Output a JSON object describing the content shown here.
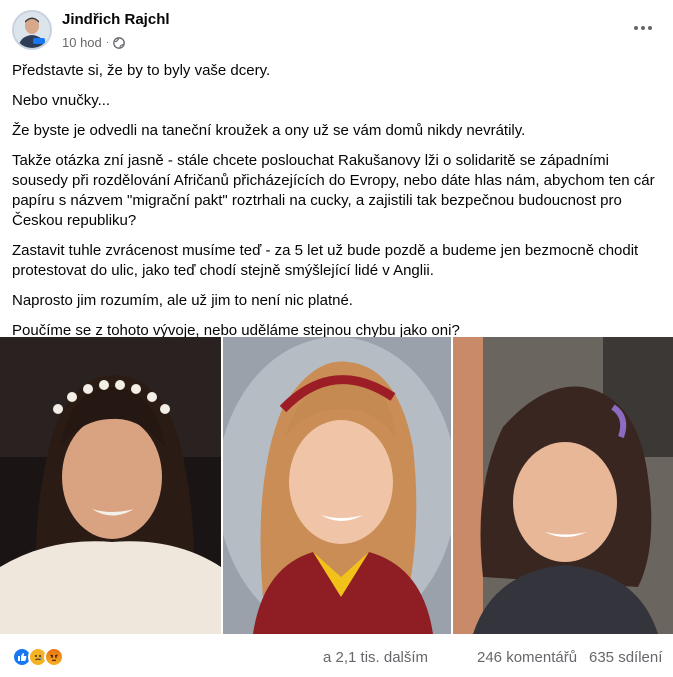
{
  "post": {
    "author": "Jindřich Rajchl",
    "avatar_badge": "PRO",
    "time": "10 hod",
    "separator": "·",
    "privacy_icon": "globe-icon",
    "more_icon": "more-options-icon",
    "paragraphs": [
      "Představte si, že by to byly vaše dcery.",
      "Nebo vnučky...",
      "Že byste je odvedli na taneční kroužek a ony už se vám domů nikdy nevrátily.",
      "Takže otázka zní jasně - stále chcete poslouchat Rakušanovy lži o solidaritě se západními sousedy při rozdělování Afričanů přicházejících do Evropy, nebo dáte hlas nám, abychom ten cár papíru s názvem \"migrační pakt\" roztrhali na cucky, a zajistili tak bezpečnou budoucnost pro Českou republiku?",
      "Zastavit tuhle zvrácenost musíme teď - za 5 let už bude pozdě a budeme jen bezmocně chodit protestovat do ulic, jako teď chodí stejně smýšlející lidé v Anglii.",
      "Naprosto jim rozumím, ale už jim to není nic platné.",
      "Poučíme se z tohoto vývoje, nebo uděláme stejnou chybu jako oni?"
    ],
    "photos": [
      "photo-1",
      "photo-2",
      "photo-3"
    ]
  },
  "footer": {
    "reaction_icons": [
      "like-icon",
      "sad-icon",
      "angry-icon"
    ],
    "reaction_count": "a 2,1 tis. dalším",
    "comments": "246 komentářů",
    "shares": "635 sdílení"
  },
  "colors": {
    "text": "#050505",
    "secondary": "#65676b",
    "like_blue": "#1877f2"
  }
}
